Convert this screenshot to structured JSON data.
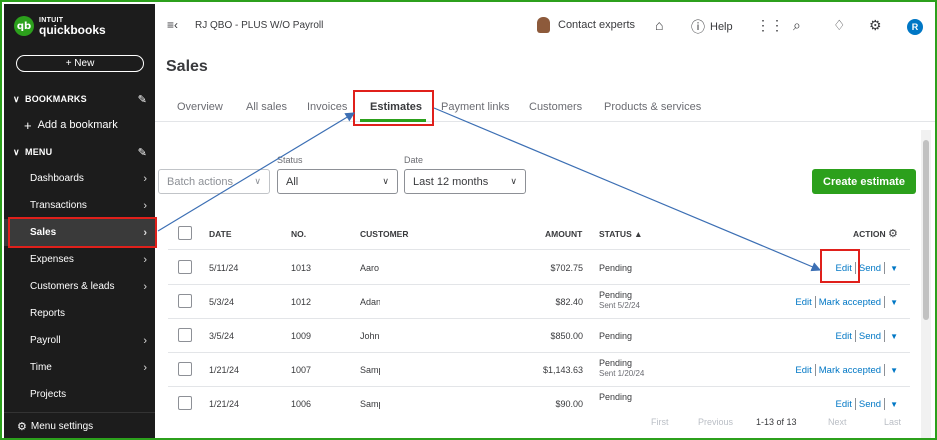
{
  "brand": {
    "intuit": "INTUIT",
    "product": "quickbooks",
    "logo_letters": "qb",
    "accent": "#2ca01c"
  },
  "sidebar": {
    "new_label": "+ New",
    "bookmarks_label": "BOOKMARKS",
    "add_bookmark_label": "Add a bookmark",
    "menu_label": "MENU",
    "items": [
      {
        "label": "Dashboards",
        "arrow": true
      },
      {
        "label": "Transactions",
        "arrow": true
      },
      {
        "label": "Sales",
        "arrow": true,
        "active": true
      },
      {
        "label": "Expenses",
        "arrow": true
      },
      {
        "label": "Customers & leads",
        "arrow": true
      },
      {
        "label": "Reports",
        "arrow": false
      },
      {
        "label": "Payroll",
        "arrow": true
      },
      {
        "label": "Time",
        "arrow": true
      },
      {
        "label": "Projects",
        "arrow": false
      }
    ],
    "menu_settings_label": "Menu settings"
  },
  "topbar": {
    "company": "RJ QBO - PLUS W/O Payroll",
    "contact_experts": "Contact experts",
    "help": "Help",
    "user_initial": "R"
  },
  "page": {
    "title": "Sales"
  },
  "tabs": [
    "Overview",
    "All sales",
    "Invoices",
    "Estimates",
    "Payment links",
    "Customers",
    "Products & services"
  ],
  "active_tab": "Estimates",
  "filters": {
    "batch_actions": "Batch actions",
    "status_label": "Status",
    "status_value": "All",
    "date_label": "Date",
    "date_value": "Last 12 months",
    "create_label": "Create estimate"
  },
  "table": {
    "columns": {
      "date": "DATE",
      "no": "NO.",
      "customer": "CUSTOMER",
      "amount": "AMOUNT",
      "status": "STATUS ▲",
      "action": "ACTION"
    },
    "rows": [
      {
        "date": "5/11/24",
        "no": "1013",
        "customer": "Aaro",
        "amount": "$702.75",
        "status": "Pending",
        "sub": "",
        "primary": "Edit",
        "secondary": "Send"
      },
      {
        "date": "5/3/24",
        "no": "1012",
        "customer": "Adan",
        "amount": "$82.40",
        "status": "Pending",
        "sub": "Sent 5/2/24",
        "primary": "Edit",
        "secondary": "Mark accepted"
      },
      {
        "date": "3/5/24",
        "no": "1009",
        "customer": "John",
        "amount": "$850.00",
        "status": "Pending",
        "sub": "",
        "primary": "Edit",
        "secondary": "Send"
      },
      {
        "date": "1/21/24",
        "no": "1007",
        "customer": "Samp",
        "amount": "$1,143.63",
        "status": "Pending",
        "sub": "Sent 1/20/24",
        "primary": "Edit",
        "secondary": "Mark accepted"
      },
      {
        "date": "1/21/24",
        "no": "1006",
        "customer": "Samp",
        "amount": "$90.00",
        "status": "Pending",
        "sub": "",
        "primary": "Edit",
        "secondary": "Send"
      }
    ]
  },
  "pagination": {
    "first": "First",
    "previous": "Previous",
    "range": "1-13 of 13",
    "next": "Next",
    "last": "Last"
  },
  "annotation_color": "#e0201b",
  "arrow_color": "#3c6fb4"
}
